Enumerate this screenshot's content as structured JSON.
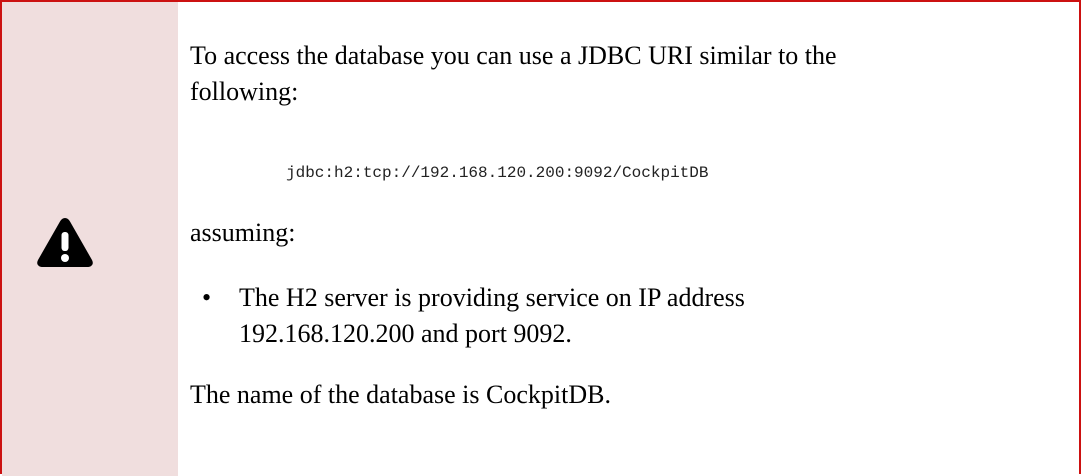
{
  "callout": {
    "icon": "warning-icon",
    "accent_color": "#cc1111",
    "icon_column_color": "#f0dede",
    "intro": "To access the database you can use a JDBC URI similar to the following:",
    "code": "jdbc:h2:tcp://192.168.120.200:9092/CockpitDB",
    "assuming": "assuming:",
    "bullet_symbol": "•",
    "bullets": [
      "The H2 server is providing service on IP address 192.168.120.200 and port 9092."
    ],
    "closing": "The name of the database is CockpitDB."
  }
}
